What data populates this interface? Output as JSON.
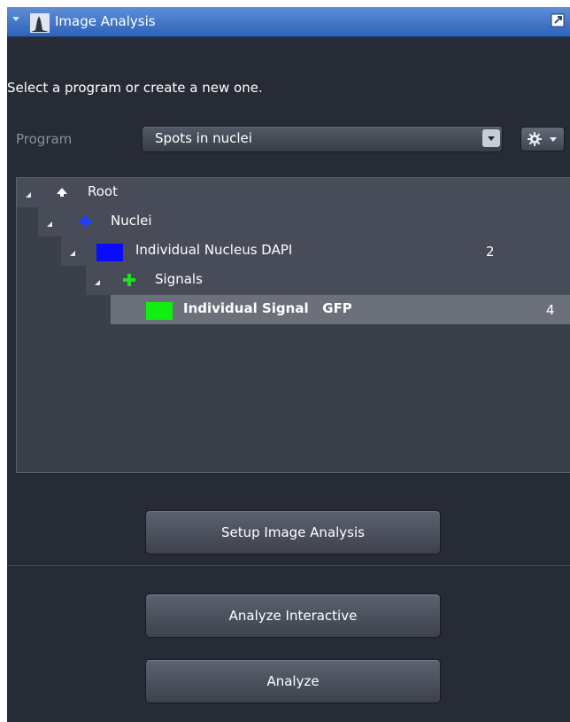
{
  "panel": {
    "title": "Image Analysis",
    "intro": "Select a program or create a new one."
  },
  "program": {
    "label": "Program",
    "value": "Spots in nuclei"
  },
  "tree": {
    "rows": [
      {
        "label": "Root",
        "icon": "up-arrow-icon"
      },
      {
        "label": "Nuclei",
        "icon": "plus-icon",
        "icon_color": "#1e3cff"
      },
      {
        "label": "Individual Nucleus DAPI",
        "swatch_color": "#0a0aff",
        "count": "2"
      },
      {
        "label": "Signals",
        "icon": "plus-icon",
        "icon_color": "#22dd22"
      },
      {
        "label": "Individual Signal   GFP",
        "swatch_color": "#11ee11",
        "count": "4"
      }
    ]
  },
  "buttons": {
    "setup": "Setup Image Analysis",
    "interactive": "Analyze Interactive",
    "analyze": "Analyze"
  },
  "colors": {
    "title_bar": "#3a72c8",
    "panel_bg": "#272b35",
    "selected_row": "#6b707b"
  }
}
